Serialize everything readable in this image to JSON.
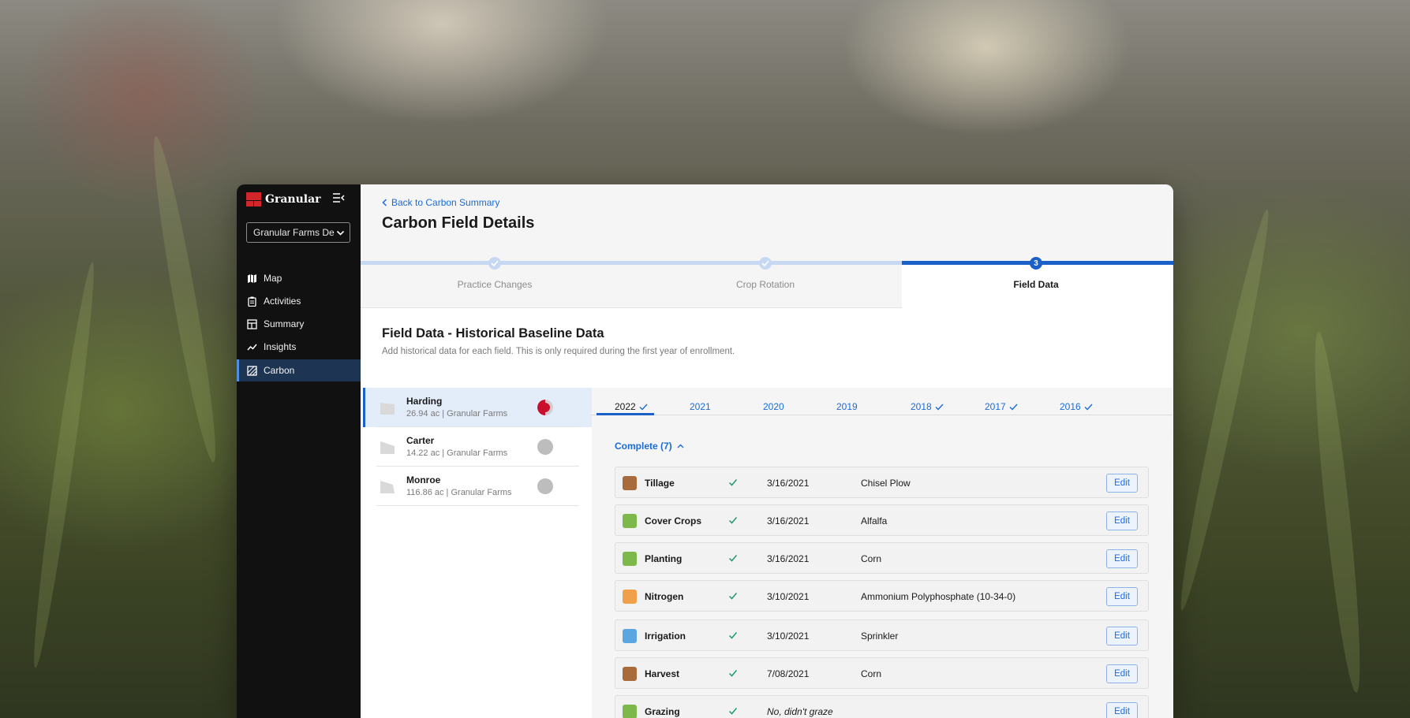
{
  "brand": {
    "name": "Granular",
    "logo_color": "#d2262b"
  },
  "org_select": {
    "value": "Granular Farms De"
  },
  "nav": {
    "items": [
      {
        "label": "Map",
        "icon": "map-icon"
      },
      {
        "label": "Activities",
        "icon": "clipboard-icon"
      },
      {
        "label": "Summary",
        "icon": "summary-icon"
      },
      {
        "label": "Insights",
        "icon": "trend-line-icon"
      },
      {
        "label": "Carbon",
        "icon": "carbon-icon"
      }
    ],
    "active": "Carbon"
  },
  "header": {
    "back_label": "Back to Carbon Summary",
    "title": "Carbon Field Details"
  },
  "steps": [
    {
      "label": "Practice Changes",
      "state": "complete"
    },
    {
      "label": "Crop Rotation",
      "state": "complete"
    },
    {
      "label": "Field Data",
      "state": "current",
      "number": "3"
    }
  ],
  "section": {
    "title": "Field Data - Historical Baseline Data",
    "subtitle": "Add historical data for each field. This is only required during the first year of enrollment."
  },
  "fields": [
    {
      "name": "Harding",
      "meta": "26.94 ac | Granular Farms",
      "selected": true,
      "status": "partial"
    },
    {
      "name": "Carter",
      "meta": "14.22 ac  | Granular Farms",
      "selected": false,
      "status": "empty"
    },
    {
      "name": "Monroe",
      "meta": "116.86 ac  | Granular Farms",
      "selected": false,
      "status": "empty"
    }
  ],
  "years": [
    {
      "label": "2022",
      "checked": true,
      "current": true
    },
    {
      "label": "2021",
      "checked": false
    },
    {
      "label": "2020",
      "checked": false
    },
    {
      "label": "2019",
      "checked": false
    },
    {
      "label": "2018",
      "checked": true
    },
    {
      "label": "2017",
      "checked": true
    },
    {
      "label": "2016",
      "checked": true
    }
  ],
  "complete_toggle": {
    "label": "Complete (7)"
  },
  "activities": [
    {
      "activity": "Tillage",
      "date": "3/16/2021",
      "detail": "Chisel Plow",
      "icon": "tillage-icon",
      "icon_color": "#a86b3c"
    },
    {
      "activity": "Cover Crops",
      "date": "3/16/2021",
      "detail": "Alfalfa",
      "icon": "sprout-icon",
      "icon_color": "#7cb84a"
    },
    {
      "activity": "Planting",
      "date": "3/16/2021",
      "detail": "Corn",
      "icon": "sprout-icon",
      "icon_color": "#7cb84a"
    },
    {
      "activity": "Nitrogen",
      "date": "3/10/2021",
      "detail": "Ammonium Polyphosphate (10-34-0)",
      "icon": "nitrogen-icon",
      "icon_color": "#f0a04b"
    },
    {
      "activity": "Irrigation",
      "date": "3/10/2021",
      "detail": "Sprinkler",
      "icon": "water-drop-icon",
      "icon_color": "#5aa6e0"
    },
    {
      "activity": "Harvest",
      "date": "7/08/2021",
      "detail": "Corn",
      "icon": "harvest-icon",
      "icon_color": "#a86b3c"
    },
    {
      "activity": "Grazing",
      "date": "",
      "detail": "No, didn't graze",
      "icon": "grazing-icon",
      "icon_color": "#7cb84a"
    }
  ],
  "edit_label": "Edit",
  "colors": {
    "accent": "#1b5fc9",
    "link": "#1a6bd8",
    "success": "#1d9a6c",
    "partial": "#c8102e"
  }
}
